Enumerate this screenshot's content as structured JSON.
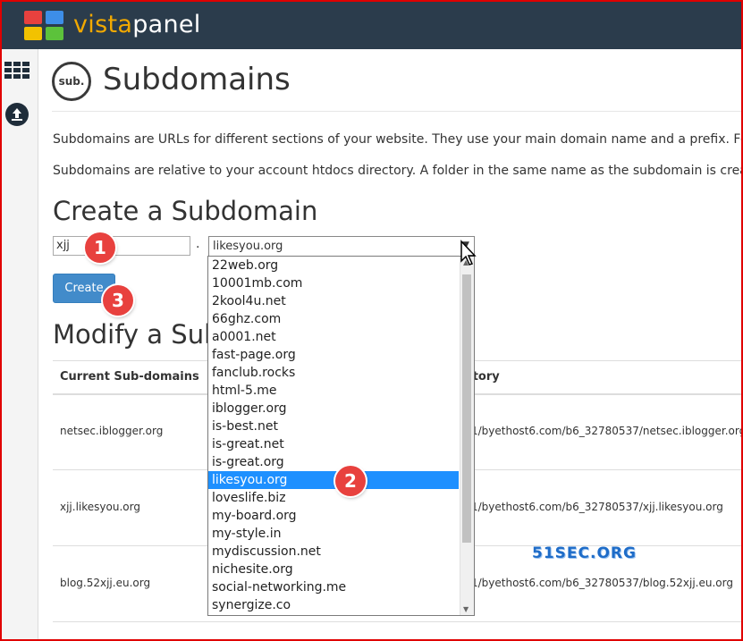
{
  "brand": {
    "logo_part1": "vista",
    "logo_part2": "panel"
  },
  "page": {
    "title": "Subdomains",
    "icon_text": "sub.",
    "intro_1": "Subdomains are URLs for different sections of your website. They use your main domain name and a prefix. For exa",
    "intro_2": "Subdomains are relative to your account htdocs directory. A folder in the same name as the subdomain is created f"
  },
  "create": {
    "heading": "Create a Subdomain",
    "subdomain_value": "xjj",
    "separator": ".",
    "selected_domain": "likesyou.org",
    "button_label": "Create"
  },
  "modify": {
    "heading": "Modify a Sub",
    "columns": [
      "Current Sub-domains",
      "ctory"
    ],
    "rows": [
      {
        "name": "netsec.iblogger.org",
        "path": "_1/byethost6.com/b6_32780537/netsec.iblogger.org"
      },
      {
        "name": "xjj.likesyou.org",
        "path": "_1/byethost6.com/b6_32780537/xjj.likesyou.org"
      },
      {
        "name": "blog.52xjj.eu.org",
        "path": "_1/byethost6.com/b6_32780537/blog.52xjj.eu.org"
      }
    ]
  },
  "dropdown": {
    "options": [
      "22web.org",
      "10001mb.com",
      "2kool4u.net",
      "66ghz.com",
      "a0001.net",
      "fast-page.org",
      "fanclub.rocks",
      "html-5.me",
      "iblogger.org",
      "is-best.net",
      "is-great.net",
      "is-great.org",
      "likesyou.org",
      "loveslife.biz",
      "my-board.org",
      "my-style.in",
      "mydiscussion.net",
      "nichesite.org",
      "social-networking.me",
      "synergize.co"
    ],
    "selected_index": 12
  },
  "annotations": {
    "step1": "1",
    "step2": "2",
    "step3": "3"
  },
  "watermark": "51SEC.ORG",
  "colors": {
    "topbar": "#2b3c4c",
    "accent": "#428bca",
    "selection": "#1e90ff",
    "badge": "#e8413e",
    "frame": "#e00000"
  },
  "icons": [
    "grid-icon",
    "upload-icon",
    "sub-logo-icon",
    "chevron-down-icon",
    "mouse-cursor-icon"
  ]
}
